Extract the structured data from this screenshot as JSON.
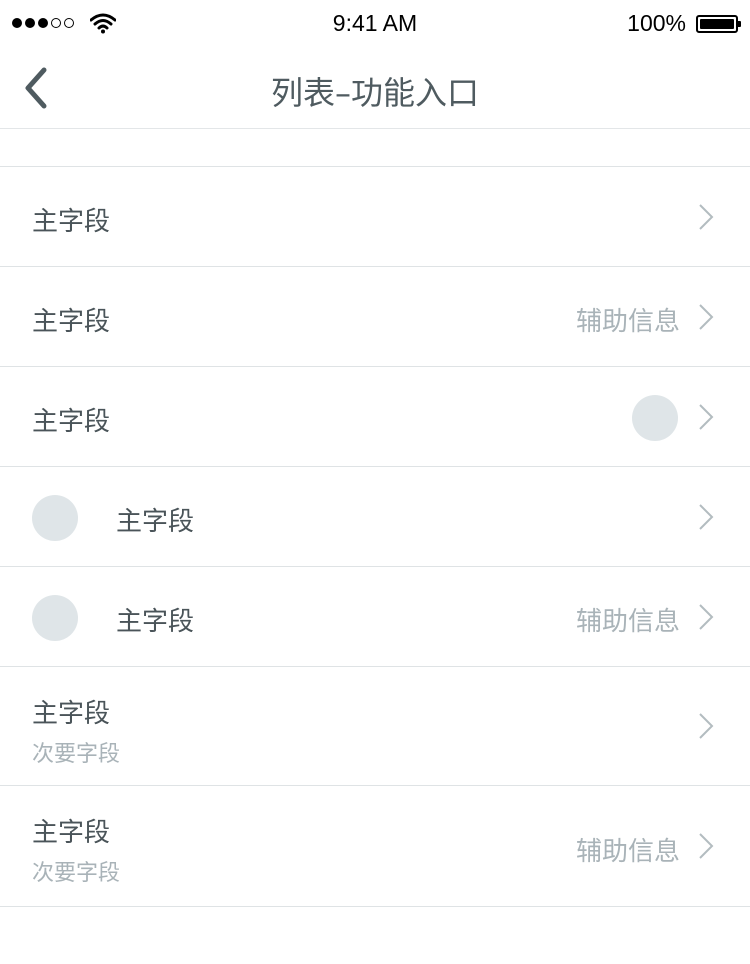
{
  "status_bar": {
    "time": "9:41 AM",
    "battery_percent": "100%",
    "signal_bars_filled": 3,
    "signal_bars_total": 5,
    "wifi_icon": "wifi-icon",
    "battery_icon": "battery-icon"
  },
  "nav": {
    "title": "列表–功能入口",
    "back_icon": "chevron-left-icon"
  },
  "list": {
    "items": [
      {
        "primary": "主字段",
        "aux": "",
        "secondary": "",
        "avatar": "none"
      },
      {
        "primary": "主字段",
        "aux": "辅助信息",
        "secondary": "",
        "avatar": "none"
      },
      {
        "primary": "主字段",
        "aux": "",
        "secondary": "",
        "avatar": "right"
      },
      {
        "primary": "主字段",
        "aux": "",
        "secondary": "",
        "avatar": "left"
      },
      {
        "primary": "主字段",
        "aux": "辅助信息",
        "secondary": "",
        "avatar": "left"
      },
      {
        "primary": "主字段",
        "aux": "",
        "secondary": "次要字段",
        "avatar": "none"
      },
      {
        "primary": "主字段",
        "aux": "辅助信息",
        "secondary": "次要字段",
        "avatar": "none"
      }
    ],
    "chevron_icon": "chevron-right-icon"
  },
  "colors": {
    "primary_text": "#4a5459",
    "muted_text": "#a9b3b8",
    "divider": "#dfe3e5",
    "avatar": "#dfe5e8"
  }
}
